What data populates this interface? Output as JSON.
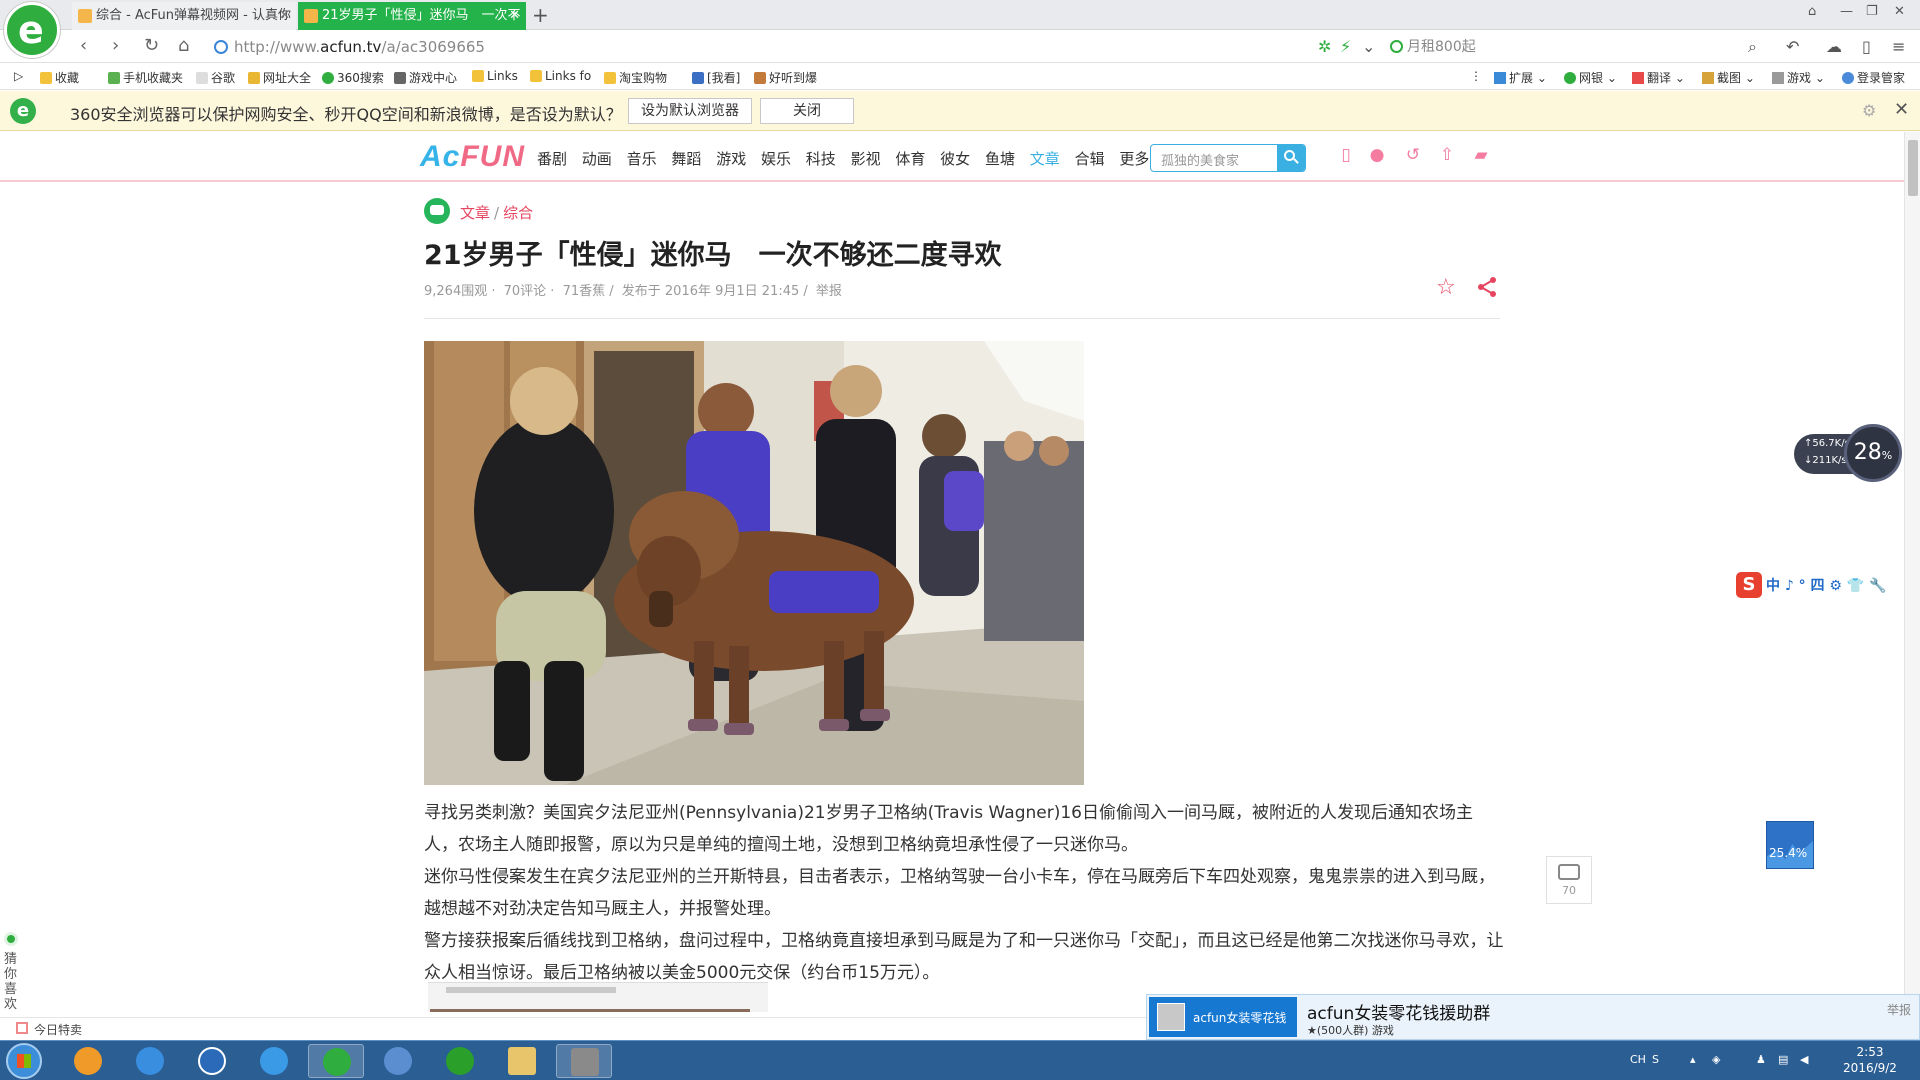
{
  "browser": {
    "tabs": [
      {
        "label": "综合 - AcFun弹幕视频网 - 认真你",
        "active": false
      },
      {
        "label": "21岁男子「性侵」迷你马　一次不",
        "active": true
      }
    ],
    "new_tab": "+",
    "url_prefix": "http://www.",
    "url_domain": "acfun.tv",
    "url_path": "/a/ac3069665",
    "search_text": "月租800起",
    "bookmarks": [
      "收藏",
      "手机收藏夹",
      "谷歌",
      "网址大全",
      "360搜索",
      "游戏中心",
      "Links",
      "Links fo",
      "淘宝购物",
      "[我看]",
      "好听到爆"
    ],
    "toolbar_right": [
      "扩展",
      "网银",
      "翻译",
      "截图",
      "游戏",
      "登录管家"
    ]
  },
  "notice": {
    "text": "360安全浏览器可以保护网购安全、秒开QQ空间和新浪微博，是否设为默认？",
    "set_default_label": "设为默认浏览器",
    "close_label": "关闭"
  },
  "site": {
    "logo_a": "Ac",
    "logo_fun": "FUN",
    "nav": [
      "番剧",
      "动画",
      "音乐",
      "舞蹈",
      "游戏",
      "娱乐",
      "科技",
      "影视",
      "体育",
      "彼女",
      "鱼塘",
      "文章",
      "合辑",
      "更多"
    ],
    "active_nav": "文章",
    "search_placeholder": "孤独的美食家"
  },
  "article": {
    "breadcrumb": [
      "文章",
      "综合"
    ],
    "title": "21岁男子「性侵」迷你马　一次不够还二度寻欢",
    "meta": {
      "views": "9,264围观 ·",
      "comments": "70评论 ·",
      "bananas": "71香蕉 /",
      "published": "发布于 2016年 9月1日 21:45 /",
      "report": "举报"
    },
    "paragraphs": [
      "寻找另类刺激？美国宾夕法尼亚州(Pennsylvania)21岁男子卫格纳(Travis Wagner)16日偷偷闯入一间马厩，被附近的人发现后通知农场主人，农场主人随即报警，原以为只是单纯的擅闯土地，没想到卫格纳竟坦承性侵了一只迷你马。",
      "迷你马性侵案发生在宾夕法尼亚州的兰开斯特县，目击者表示，卫格纳驾驶一台小卡车，停在马厩旁后下车四处观察，鬼鬼祟祟的进入到马厩，越想越不对劲决定告知马厩主人，并报警处理。",
      "警方接获报案后循线找到卫格纳，盘问过程中，卫格纳竟直接坦承到马厩是为了和一只迷你马「交配」，而且这已经是他第二次找迷你马寻欢，让众人相当惊讶。最后卫格纳被以美金5000元交保（约台币15万元）。"
    ],
    "comment_count": "70"
  },
  "widgets": {
    "net_up": "↑56.7K/s",
    "net_down": "↓211K/s",
    "mem_percent": "28",
    "mem_unit": "%",
    "ime_text": "中 ♪ ° 四 ⚙ 👕 🔧",
    "cpu_percent": "25.4%",
    "side_label": "猜你喜欢",
    "daily_label": "今日特卖"
  },
  "qq_popup": {
    "tab_name": "acfun女装零花钱",
    "group_name": "acfun女装零花钱援助群",
    "group_info": "★(500人群) 游戏",
    "report": "举报"
  },
  "taskbar": {
    "tray_text": "CH",
    "time": "2:53",
    "date": "2016/9/2"
  },
  "colors": {
    "browser_green": "#24b24a",
    "acfun_blue": "#36b3e8",
    "acfun_pink": "#f06a86",
    "breadcrumb_red": "#e6455f"
  }
}
